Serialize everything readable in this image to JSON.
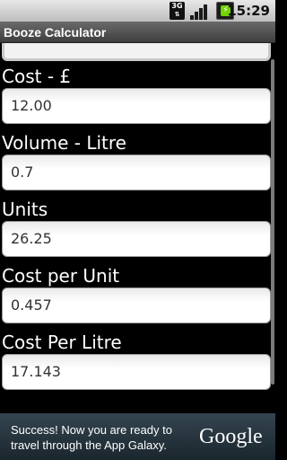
{
  "status_bar": {
    "network": "3G",
    "time": "15:29"
  },
  "app": {
    "title": "Booze Calculator"
  },
  "fields": [
    {
      "label": "Cost - £",
      "value": "12.00"
    },
    {
      "label": "Volume - Litre",
      "value": "0.7"
    },
    {
      "label": "Units",
      "value": "26.25"
    },
    {
      "label": "Cost per Unit",
      "value": "0.457"
    },
    {
      "label": "Cost Per Litre",
      "value": "17.143"
    }
  ],
  "ad": {
    "message": "Success! Now you are ready to travel through the App Galaxy.",
    "brand": "Google"
  }
}
